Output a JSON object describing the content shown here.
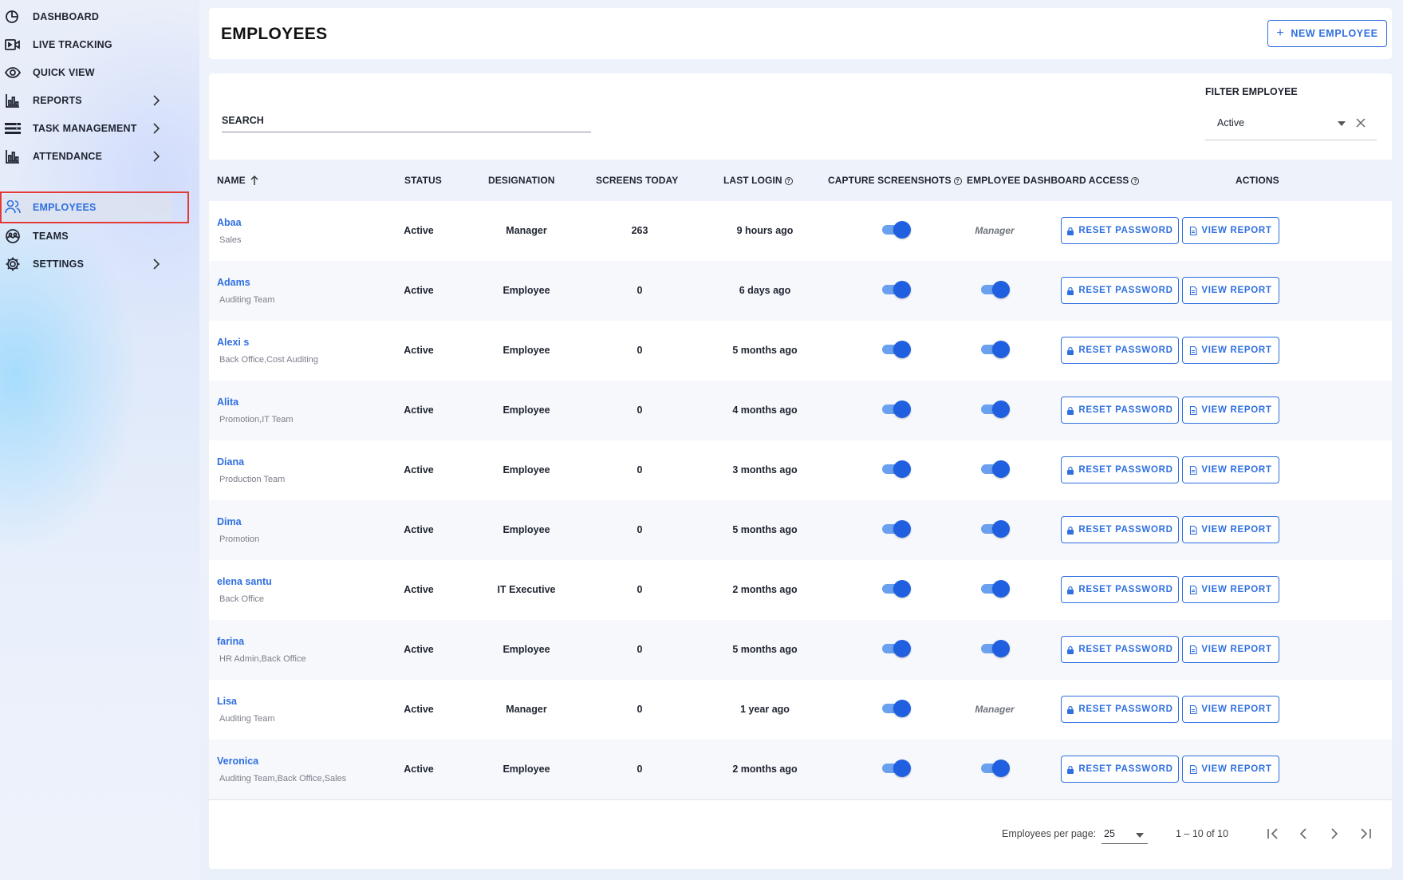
{
  "sidebar": {
    "items": [
      {
        "id": "dashboard",
        "label": "DASHBOARD",
        "icon": "dashboard-icon",
        "has_children": false
      },
      {
        "id": "live-tracking",
        "label": "LIVE TRACKING",
        "icon": "video-camera-icon",
        "has_children": false
      },
      {
        "id": "quick-view",
        "label": "QUICK VIEW",
        "icon": "eye-icon",
        "has_children": false
      },
      {
        "id": "reports",
        "label": "REPORTS",
        "icon": "report-chart-icon",
        "has_children": true
      },
      {
        "id": "task-management",
        "label": "TASK MANAGEMENT",
        "icon": "task-list-icon",
        "has_children": true
      },
      {
        "id": "attendance",
        "label": "ATTENDANCE",
        "icon": "attendance-chart-icon",
        "has_children": true
      },
      {
        "id": "employees",
        "label": "EMPLOYEES",
        "icon": "people-icon",
        "has_children": false,
        "active": true
      },
      {
        "id": "teams",
        "label": "TEAMS",
        "icon": "teams-icon",
        "has_children": false
      },
      {
        "id": "settings",
        "label": "SETTINGS",
        "icon": "gear-icon",
        "has_children": true
      }
    ]
  },
  "header": {
    "title": "EMPLOYEES",
    "new_button_label": "NEW EMPLOYEE"
  },
  "search": {
    "placeholder": "SEARCH",
    "value": ""
  },
  "filter": {
    "label": "FILTER EMPLOYEE",
    "value": "Active"
  },
  "table": {
    "columns": {
      "name": "NAME",
      "status": "STATUS",
      "designation": "DESIGNATION",
      "screens_today": "SCREENS TODAY",
      "last_login": "LAST LOGIN",
      "capture_screenshots": "CAPTURE SCREENSHOTS",
      "dashboard_access": "EMPLOYEE DASHBOARD ACCESS",
      "actions": "ACTIONS"
    },
    "reset_label": "RESET PASSWORD",
    "report_label": "VIEW REPORT",
    "rows": [
      {
        "name": "Abaa",
        "team": "Sales",
        "status": "Active",
        "designation": "Manager",
        "screens": "263",
        "last_login": "9 hours ago",
        "capture": true,
        "access": "Manager"
      },
      {
        "name": "Adams",
        "team": "Auditing Team",
        "status": "Active",
        "designation": "Employee",
        "screens": "0",
        "last_login": "6 days ago",
        "capture": true,
        "access": "toggle"
      },
      {
        "name": "Alexi s",
        "team": "Back Office,Cost Auditing",
        "status": "Active",
        "designation": "Employee",
        "screens": "0",
        "last_login": "5 months ago",
        "capture": true,
        "access": "toggle"
      },
      {
        "name": "Alita",
        "team": "Promotion,IT Team",
        "status": "Active",
        "designation": "Employee",
        "screens": "0",
        "last_login": "4 months ago",
        "capture": true,
        "access": "toggle"
      },
      {
        "name": "Diana",
        "team": "Production Team",
        "status": "Active",
        "designation": "Employee",
        "screens": "0",
        "last_login": "3 months ago",
        "capture": true,
        "access": "toggle"
      },
      {
        "name": "Dima",
        "team": "Promotion",
        "status": "Active",
        "designation": "Employee",
        "screens": "0",
        "last_login": "5 months ago",
        "capture": true,
        "access": "toggle"
      },
      {
        "name": "elena santu",
        "team": "Back Office",
        "status": "Active",
        "designation": "IT Executive",
        "screens": "0",
        "last_login": "2 months ago",
        "capture": true,
        "access": "toggle"
      },
      {
        "name": "farina",
        "team": "HR Admin,Back Office",
        "status": "Active",
        "designation": "Employee",
        "screens": "0",
        "last_login": "5 months ago",
        "capture": true,
        "access": "toggle"
      },
      {
        "name": "Lisa",
        "team": "Auditing Team",
        "status": "Active",
        "designation": "Manager",
        "screens": "0",
        "last_login": "1 year ago",
        "capture": true,
        "access": "Manager"
      },
      {
        "name": "Veronica",
        "team": "Auditing Team,Back Office,Sales",
        "status": "Active",
        "designation": "Employee",
        "screens": "0",
        "last_login": "2 months ago",
        "capture": true,
        "access": "toggle"
      }
    ]
  },
  "pagination": {
    "per_page_label": "Employees per page:",
    "per_page_value": "25",
    "range_label": "1 – 10 of 10"
  },
  "colors": {
    "accent": "#2f6fe0",
    "active_outline": "#e53935",
    "toggle_track": "#6aa0f0",
    "toggle_knob": "#1f5fe0"
  }
}
